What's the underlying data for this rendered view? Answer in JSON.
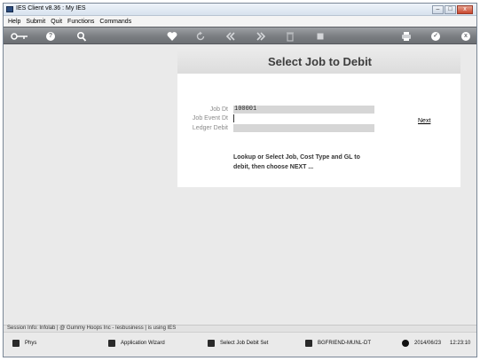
{
  "window": {
    "title": "IES Client v8.36 : My IES",
    "buttons": [
      "–",
      "□",
      "x"
    ]
  },
  "menu": [
    "Help",
    "Submit",
    "Quit",
    "Functions",
    "Commands"
  ],
  "toolbar": {
    "icons": [
      "key-icon",
      "help-icon",
      "search-icon",
      "heart-icon",
      "refresh-icon",
      "rewind-icon",
      "forward-icon",
      "trash-icon",
      "stop-icon",
      "printer-icon",
      "check-icon",
      "close-icon"
    ],
    "help_glyph": "?",
    "check_glyph": "✓",
    "close_glyph": "x"
  },
  "panel": {
    "title": "Select Job to Debit",
    "fields": [
      {
        "label": "Job Dt",
        "value": "100001"
      },
      {
        "label": "Job Event Dt",
        "value": ""
      },
      {
        "label": "Ledger Debit",
        "value": ""
      }
    ],
    "next_label": "Next",
    "instruction": "Lookup or Select Job, Cost Type and GL to debit, then choose NEXT ..."
  },
  "session_info": "Session Info: Infolab | @ Gummy Hoops Inc   - Iesbusiness | is using IES",
  "status": {
    "phys": "Phys",
    "wizard": "Application Wizard",
    "task": "Select Job Debit Set",
    "machine": "BGFRIEND-MUNL-DT",
    "date": "2014/06/23",
    "time": "12:23:10"
  }
}
